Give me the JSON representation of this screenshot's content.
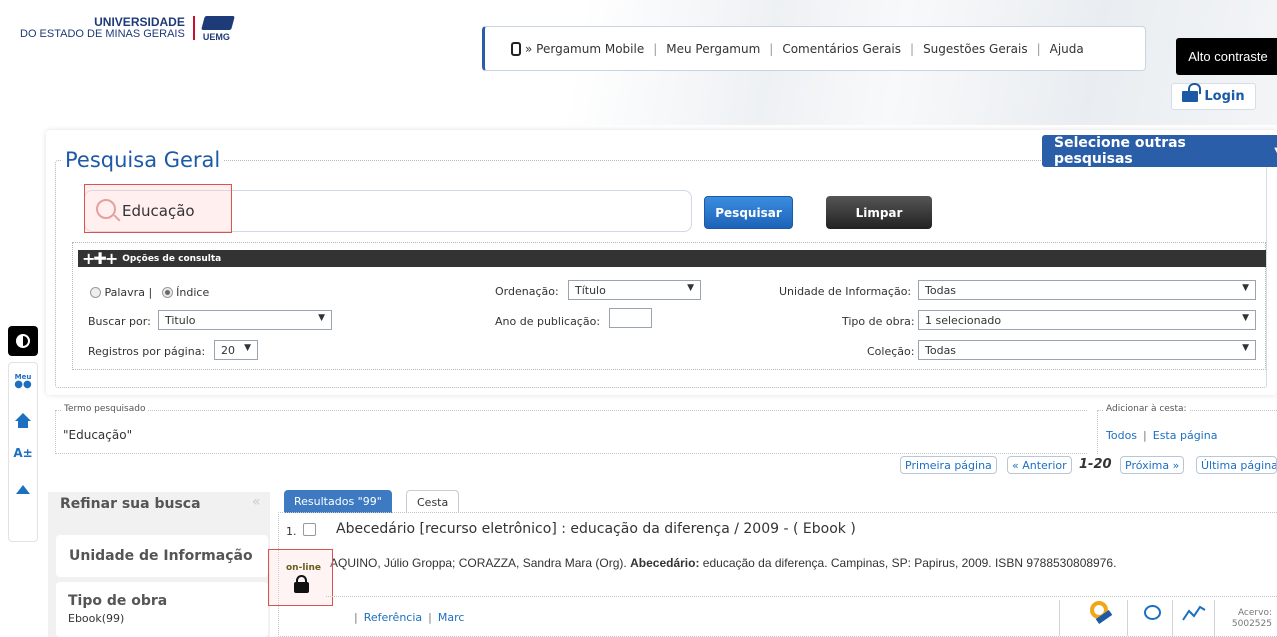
{
  "header": {
    "logo_line1": "UNIVERSIDADE",
    "logo_line2": "DO ESTADO DE MINAS GERAIS",
    "logo_abbr": "UEMG",
    "nav": [
      "» Pergamum Mobile",
      "Meu Pergamum",
      "Comentários Gerais",
      "Sugestões Gerais",
      "Ajuda"
    ],
    "contrast_label": "Alto contraste",
    "login_label": "Login"
  },
  "side": {
    "meu_label": "Meu",
    "font_label": "A±"
  },
  "search": {
    "title": "Pesquisa Geral",
    "other_searches": "Selecione outras pesquisas",
    "query": "Educação",
    "search_button": "Pesquisar",
    "clear_button": "Limpar",
    "options_title": "Opções de consulta",
    "radio_palavra": "Palavra |",
    "radio_indice": "Índice",
    "buscar_por_label": "Buscar por:",
    "buscar_por_value": "Titulo",
    "registros_label": "Registros por página:",
    "registros_value": "20",
    "ordenacao_label": "Ordenação:",
    "ordenacao_value": "Título",
    "ano_label": "Ano de publicação:",
    "unidade_label": "Unidade de Informação:",
    "unidade_value": "Todas",
    "tipo_label": "Tipo de obra:",
    "tipo_value": "1 selecionado",
    "colecao_label": "Coleção:",
    "colecao_value": "Todas"
  },
  "term": {
    "label": "Termo pesquisado",
    "value": "\"Educação\"",
    "basket_label": "Adicionar à cesta:",
    "basket_all": "Todos",
    "basket_page": "Esta página"
  },
  "pagination": {
    "first": "Primeira página",
    "prev": "« Anterior",
    "range": "1-20",
    "next": "Próxima »",
    "last": "Última página"
  },
  "refine": {
    "title": "Refinar sua busca",
    "collapse": "«",
    "sections": [
      {
        "title": "Unidade de Informação",
        "sub": ""
      },
      {
        "title": "Tipo de obra",
        "sub": "Ebook(99)"
      }
    ]
  },
  "results": {
    "tab_results": "Resultados \"99\"",
    "tab_basket": "Cesta",
    "items": [
      {
        "num": "1.",
        "title": "Abecedário [recurso eletrônico] : educação da diferença / 2009 - ( Ebook )",
        "ref_authors": "AQUINO, Júlio Groppa; CORAZZA, Sandra Mara (Org).",
        "ref_title": "Abecedário:",
        "ref_rest": "educação da diferença. Campinas, SP: Papirus, 2009. ISBN 9788530808976.",
        "online_label": "on-line",
        "link_ref": "Referência",
        "link_marc": "Marc",
        "acervo_label": "Acervo:",
        "acervo_value": "5002525"
      }
    ]
  }
}
